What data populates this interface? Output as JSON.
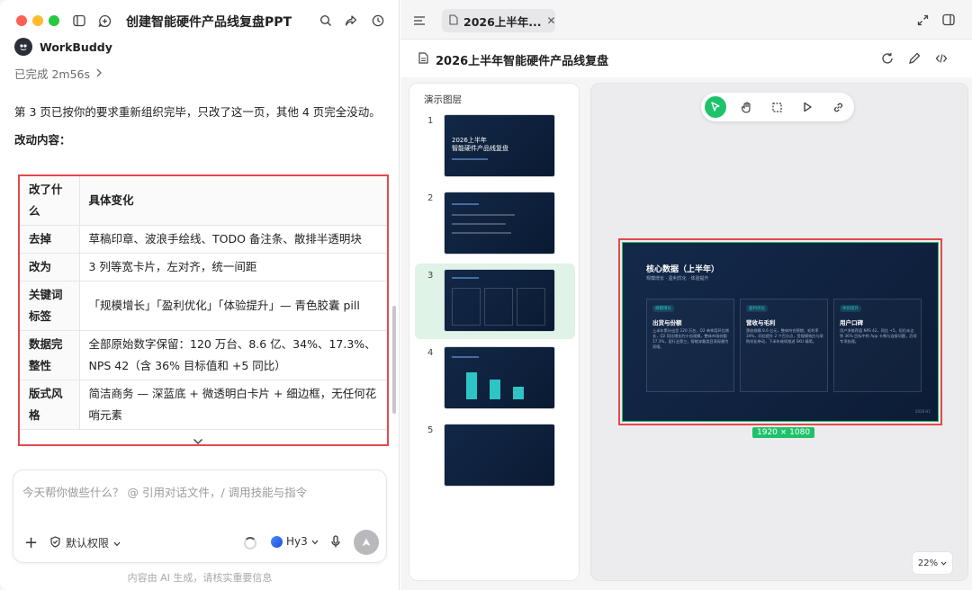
{
  "window": {
    "title": "创建智能硬件产品线复盘PPT"
  },
  "chat": {
    "agent_name": "WorkBuddy",
    "status": "已完成 2m56s",
    "message": "第 3 页已按你的要求重新组织完毕，只改了这一页，其他 4 页完全没动。",
    "subheading": "改动内容：",
    "table": {
      "headers": [
        "改了什么",
        "具体变化"
      ],
      "rows": [
        [
          "去掉",
          "草稿印章、波浪手绘线、TODO 备注条、散排半透明块"
        ],
        [
          "改为",
          "3 列等宽卡片，左对齐，统一间距"
        ],
        [
          "关键词标签",
          "「规模增长」「盈利优化」「体验提升」— 青色胶囊 pill"
        ],
        [
          "数据完整性",
          "全部原始数字保留：120 万台、8.6 亿、34%、17.3%、NPS 42（含 36% 目标值和 +5 同比）"
        ],
        [
          "版式风格",
          "简洁商务 — 深蓝底 + 微透明白卡片 + 细边框，无任何花哨元素"
        ]
      ]
    },
    "input": {
      "placeholder": "今天帮你做些什么？ @ 引用对话文件，/ 调用技能与指令",
      "permission_label": "默认权限",
      "model_label": "Hy3"
    },
    "footnote": "内容由 AI 生成，请核实重要信息"
  },
  "preview": {
    "tab_label": "2026上半年...",
    "doc_title": "2026上半年智能硬件产品线复盘",
    "thumbs_title": "演示图层",
    "slides": [
      {
        "num": "1",
        "title": "2026上半年\n智能硬件产品线复盘"
      },
      {
        "num": "2",
        "title": ""
      },
      {
        "num": "3",
        "title": ""
      },
      {
        "num": "4",
        "title": ""
      },
      {
        "num": "5",
        "title": ""
      }
    ],
    "selected_slide": 3,
    "main_slide": {
      "title": "核心数据（上半年）",
      "subtitle": "规模增长 · 盈利优化 · 体验提升",
      "cards": [
        {
          "pill": "规模增长",
          "title": "出货与份额",
          "body": "上半年累计出货 120 万台，Q2 单季度环比增长，Q2 同比增长约十倍规模，整体市场份额 17.3%，居行业第三，智能穿戴类目表现最为亮眼。"
        },
        {
          "pill": "盈利优化",
          "title": "营收与毛利",
          "body": "营收规模 8.6 亿元，整体符合预期；毛利率 34%，同比提升 2 个百分点，受规模效应与采购优化带动，下半年继续推进 SKU 精简。"
        },
        {
          "pill": "体验提升",
          "title": "用户口碑",
          "body": "用户净推荐值 NPS 42，同比 +5，但仍未达到 36% 目标中的 App 卡顿与连接问题，后续专项处理。"
        }
      ],
      "corner": "2026 H1"
    },
    "dimensions": "1920 × 1080",
    "zoom": "22%"
  }
}
